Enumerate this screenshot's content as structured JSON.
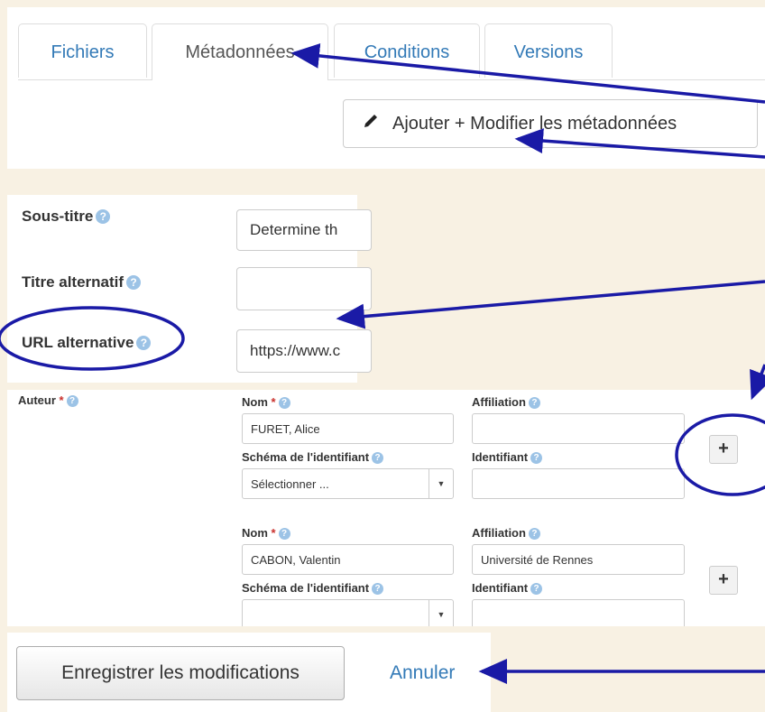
{
  "tabs": [
    "Fichiers",
    "Métadonnées",
    "Conditions",
    "Versions"
  ],
  "edit_button": {
    "label": "Ajouter + Modifier les métadonnées",
    "icon": "pencil-icon"
  },
  "form": {
    "subtitle": {
      "label": "Sous-titre",
      "value": "Determine th"
    },
    "alt_title": {
      "label": "Titre alternatif",
      "value": ""
    },
    "alt_url": {
      "label": "URL alternative",
      "value": "https://www.c"
    }
  },
  "author": {
    "label": "Auteur",
    "required_mark": "*",
    "help": "?",
    "entries": [
      {
        "nom_label": "Nom",
        "nom": "FURET, Alice",
        "affiliation_label": "Affiliation",
        "affiliation": "",
        "scheme_label": "Schéma de l'identifiant",
        "scheme": "Sélectionner ...",
        "identifier_label": "Identifiant",
        "identifier": ""
      },
      {
        "nom_label": "Nom",
        "nom": "CABON, Valentin",
        "affiliation_label": "Affiliation",
        "affiliation": "Université de Rennes",
        "scheme_label": "Schéma de l'identifiant",
        "scheme": "",
        "identifier_label": "Identifiant",
        "identifier": ""
      }
    ],
    "add_label": "+"
  },
  "actions": {
    "save": "Enregistrer les modifications",
    "cancel": "Annuler"
  },
  "colors": {
    "background": "#f8f1e3",
    "link": "#337ab7",
    "annotation": "#1a1aa6",
    "required": "#c9302c"
  }
}
